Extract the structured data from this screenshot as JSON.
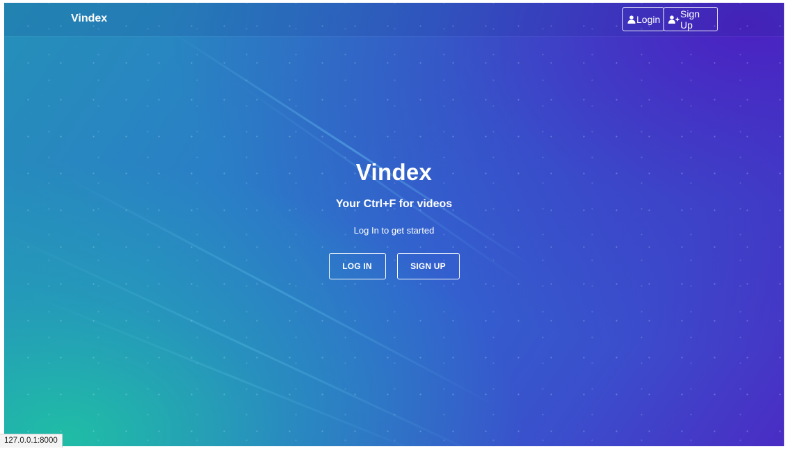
{
  "navbar": {
    "brand": "Vindex",
    "login_label": "Login",
    "signup_label": "Sign Up"
  },
  "hero": {
    "title": "Vindex",
    "tagline": "Your Ctrl+F for videos",
    "cta_text": "Log In to get started",
    "login_button": "LOG IN",
    "signup_button": "SIGN UP"
  },
  "status_bar": {
    "url": "127.0.0.1:8000"
  },
  "icons": {
    "login": "user-icon",
    "signup": "user-plus-icon"
  },
  "colors": {
    "gradient_teal": "#1ec8a0",
    "gradient_blue": "#2a7fc6",
    "gradient_purple": "#4a2cc4",
    "text": "#ffffff"
  }
}
